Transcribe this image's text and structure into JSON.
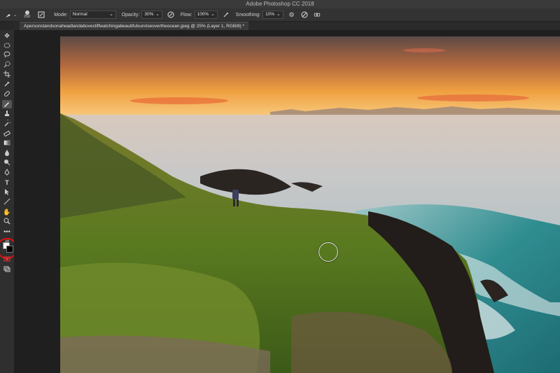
{
  "app": {
    "title": "Adobe Photoshop CC 2018"
  },
  "options": {
    "brush_size": "250",
    "mode_label": "Mode:",
    "mode_value": "Normal",
    "opacity_label": "Opacity:",
    "opacity_value": "30%",
    "flow_label": "Flow:",
    "flow_value": "100%",
    "smoothing_label": "Smoothing:",
    "smoothing_value": "10%"
  },
  "document": {
    "tab_title": "Apersonstandsonaheadlandabovecliffwatchingabeautifulsunriseovertheocean.jpeg @ 25% (Layer 1, RGB/8) *"
  },
  "tools": [
    "move-tool",
    "lasso-tool",
    "marquee-tool",
    "quick-select-tool",
    "crop-tool",
    "eyedropper-tool",
    "healing-tool",
    "brush-tool",
    "clone-stamp-tool",
    "history-brush-tool",
    "eraser-tool",
    "gradient-tool",
    "blur-tool",
    "dodge-tool",
    "pen-tool",
    "type-tool",
    "path-select-tool",
    "shape-tool",
    "hand-tool",
    "zoom-tool",
    "more-tools"
  ],
  "colors": {
    "accent": "#e01010",
    "panel": "#333333"
  }
}
